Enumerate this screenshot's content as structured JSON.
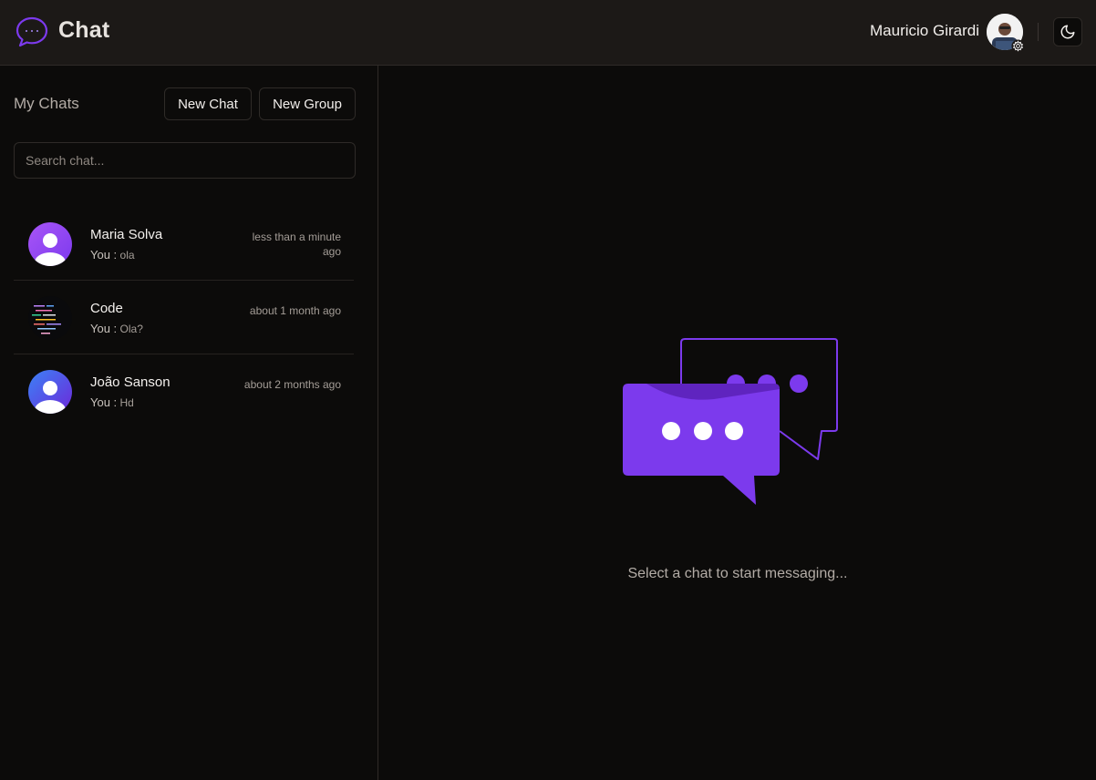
{
  "header": {
    "app_title": "Chat",
    "logo_icon": "chat-bubble-icon",
    "user_name": "Mauricio Girardi",
    "settings_icon": "gear-icon",
    "theme_icon": "moon-icon"
  },
  "sidebar": {
    "title": "My Chats",
    "new_chat_label": "New Chat",
    "new_group_label": "New Group",
    "search_placeholder": "Search chat..."
  },
  "chats": [
    {
      "name": "Maria Solva",
      "sender": "You :",
      "message": "ola",
      "time": "less than a minute ago",
      "avatar": "user-silhouette-purple"
    },
    {
      "name": "Code",
      "sender": "You :",
      "message": "Ola?",
      "time": "about 1 month ago",
      "avatar": "code-image"
    },
    {
      "name": "João Sanson",
      "sender": "You :",
      "message": "Hd",
      "time": "about 2 months ago",
      "avatar": "user-silhouette-blue"
    }
  ],
  "main": {
    "empty_message": "Select a chat to start messaging...",
    "illustration": "chat-bubbles-illustration"
  },
  "colors": {
    "accent": "#7c3aed",
    "header_bg": "#1c1917",
    "page_bg": "#0c0b0a",
    "border": "#2f2b28"
  }
}
